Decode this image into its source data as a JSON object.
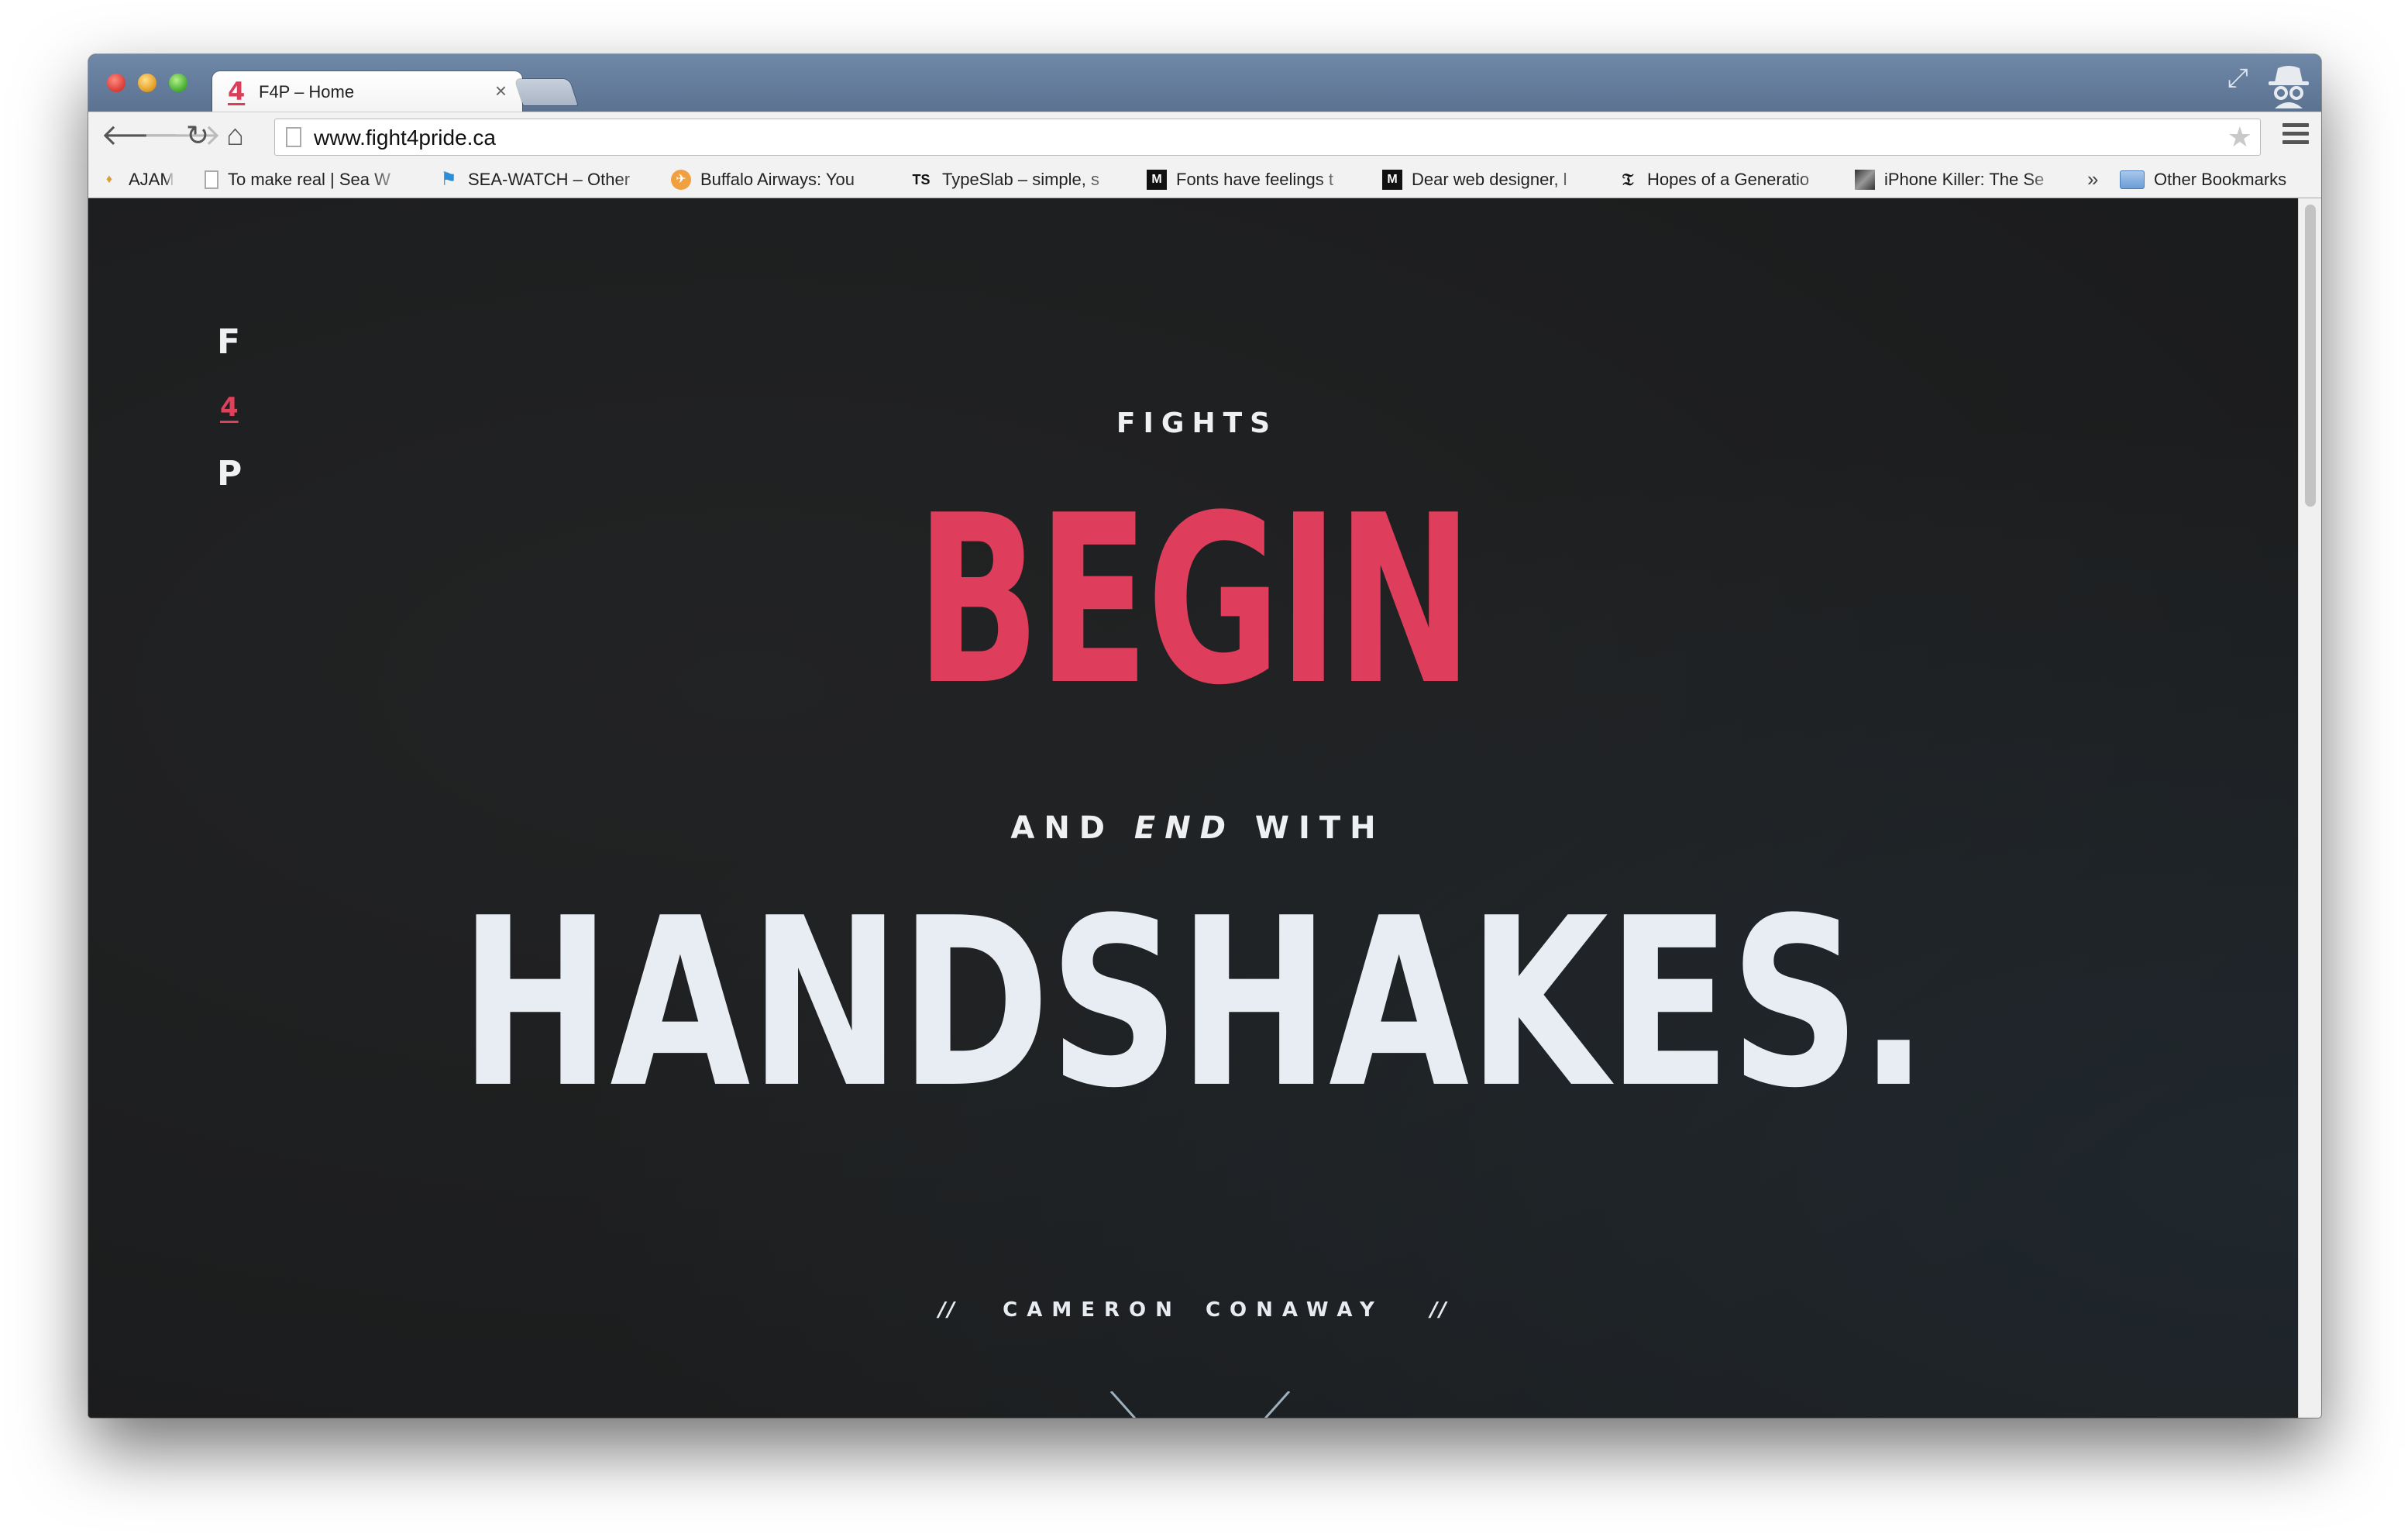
{
  "browser": {
    "tab": {
      "favicon": "4",
      "title": "F4P – Home",
      "close": "×"
    },
    "url": "www.fight4pride.ca",
    "bookmarks": [
      {
        "icon": "ajam-icon",
        "label": "AJAM"
      },
      {
        "icon": "page-icon",
        "label": "To make real | Sea W"
      },
      {
        "icon": "sea-watch-icon",
        "label": "SEA-WATCH – Other"
      },
      {
        "icon": "buffalo-icon",
        "label": "Buffalo Airways: You"
      },
      {
        "icon": "typeslab-icon",
        "label": "TypeSlab – simple, s"
      },
      {
        "icon": "medium-icon",
        "label": "Fonts have feelings t"
      },
      {
        "icon": "medium-icon",
        "label": "Dear web designer, l"
      },
      {
        "icon": "nyt-icon",
        "label": "Hopes of a Generatio"
      },
      {
        "icon": "iphone-killer-icon",
        "label": "iPhone Killer: The Se"
      }
    ],
    "bookmarks_overflow": "»",
    "other_bookmarks": "Other Bookmarks"
  },
  "page": {
    "logo": {
      "f": "F",
      "four": "4",
      "p": "P"
    },
    "kicker": "FIGHTS",
    "headline_1": "BEGIN",
    "middle": {
      "pre": "AND ",
      "emph": "END",
      "post": " WITH"
    },
    "headline_2": "HANDSHAKES.",
    "byline": {
      "left": "//",
      "name": "CAMERON CONAWAY",
      "right": "//"
    },
    "colors": {
      "accent": "#de3d5b",
      "background": "#1f2021",
      "text": "#eef0f2"
    }
  }
}
